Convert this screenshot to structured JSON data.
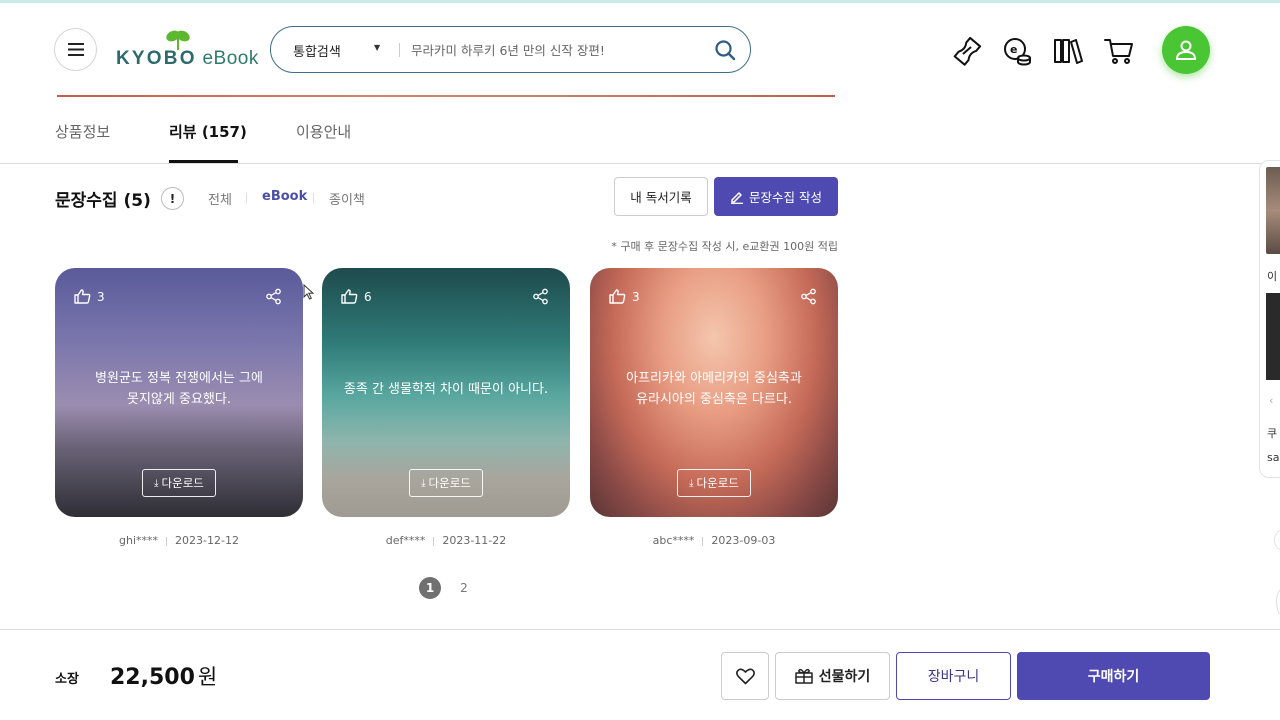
{
  "header": {
    "logo_brand": "KYOBO",
    "logo_suffix": "eBook",
    "search": {
      "category": "통합검색",
      "placeholder": "무라카미 하루키 6년 만의 신작 장편!"
    },
    "icons": [
      "menu-icon",
      "coupon-icon",
      "ecash-icon",
      "library-icon",
      "cart-icon",
      "user-icon"
    ]
  },
  "tabs": [
    {
      "label": "상품정보"
    },
    {
      "label": "리뷰 (157)"
    },
    {
      "label": "이용안내"
    }
  ],
  "section": {
    "title": "문장수집 (5)",
    "info": "!",
    "filters": [
      "전체",
      "eBook",
      "종이책"
    ],
    "record_button": "내 독서기록",
    "write_button": "문장수집 작성",
    "note": "* 구매 후 문장수집 작성 시, e교환권 100원 적립"
  },
  "cards": [
    {
      "likes": "3",
      "quote_line1": "병원균도 정복 전쟁에서는 그에",
      "quote_line2": "못지않게 중요했다.",
      "download": "다운로드",
      "user": "ghi****",
      "date": "2023-12-12"
    },
    {
      "likes": "6",
      "quote_line1": "종족 간 생물학적 차이 때문이 아니다.",
      "quote_line2": "",
      "download": "다운로드",
      "user": "def****",
      "date": "2023-11-22"
    },
    {
      "likes": "3",
      "quote_line1": "아프리카와 아메리카의 중심축과",
      "quote_line2": "유라시아의 중심축은 다르다.",
      "download": "다운로드",
      "user": "abc****",
      "date": "2023-09-03"
    }
  ],
  "pagination": {
    "pages": [
      "1",
      "2"
    ],
    "current": "1"
  },
  "side_panel": {
    "t1": "이",
    "t2": "쿠",
    "t3": "sa"
  },
  "bottom": {
    "own_label": "소장",
    "price": "22,500",
    "currency": "원",
    "gift_button": "선물하기",
    "cart_button": "장바구니",
    "buy_button": "구매하기"
  },
  "colors": {
    "accent": "#4f4ab2",
    "profile": "#4ac533",
    "search_border": "#3f6d8c"
  }
}
